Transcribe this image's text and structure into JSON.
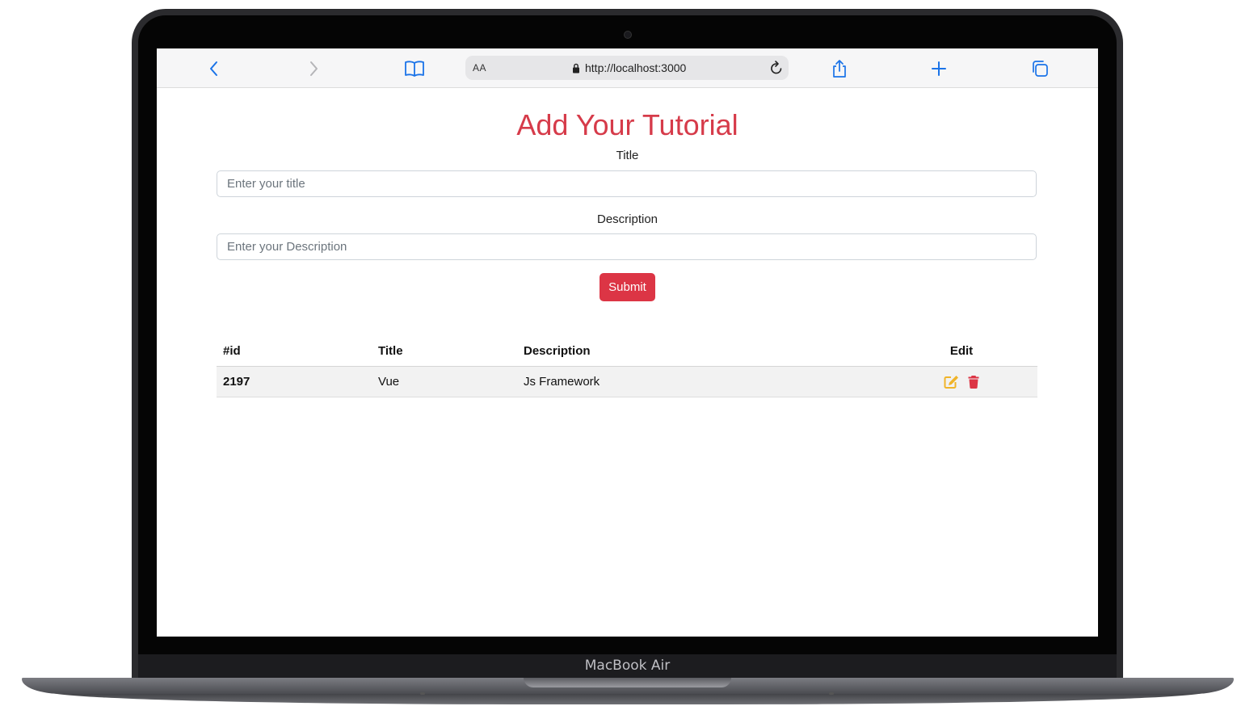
{
  "device": {
    "model_label": "MacBook Air"
  },
  "browser": {
    "text_size_label": "AA",
    "url": "http://localhost:3000",
    "icons": [
      "chevron-left-icon",
      "chevron-right-icon",
      "bookmarks-book-icon",
      "lock-icon",
      "reload-icon",
      "share-icon",
      "plus-icon",
      "tabs-icon"
    ]
  },
  "form": {
    "heading": "Add Your Tutorial",
    "title_label": "Title",
    "title_placeholder": "Enter your title",
    "title_value": "",
    "description_label": "Description",
    "description_placeholder": "Enter your Description",
    "description_value": "",
    "submit_label": "Submit"
  },
  "table": {
    "headers": {
      "id": "#id",
      "title": "Title",
      "description": "Description",
      "edit": "Edit"
    },
    "rows": [
      {
        "id": "2197",
        "title": "Vue",
        "description": "Js Framework"
      }
    ],
    "action_icons": [
      "edit-icon",
      "trash-icon"
    ]
  },
  "colors": {
    "accent_red": "#dc3545",
    "heading_red": "#d63b4a",
    "edit_yellow": "#f0b429",
    "ios_blue": "#1a73e8"
  }
}
